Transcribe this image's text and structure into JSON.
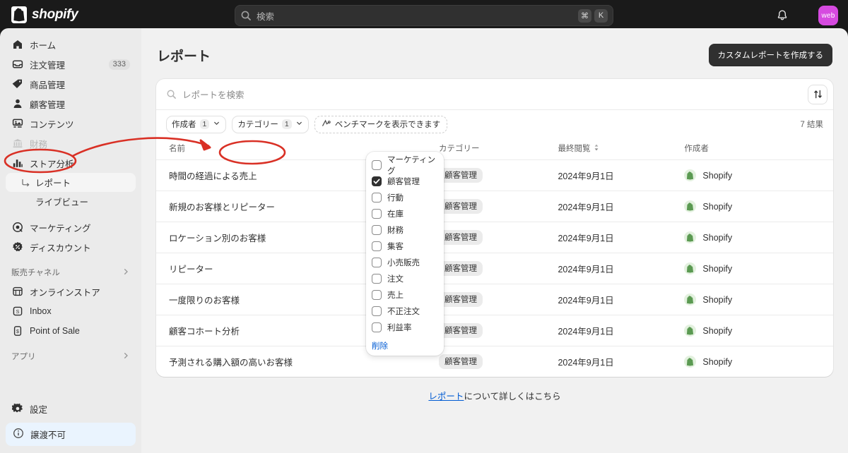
{
  "topbar": {
    "brand": "shopify",
    "search": {
      "placeholder": "検索",
      "icon": "search-icon",
      "key_cmd": "⌘",
      "key_k": "K"
    },
    "notifications_icon": "bell-icon",
    "avatar_initials": "web",
    "avatar_color": "#d64ae0"
  },
  "sidebar": {
    "items": [
      {
        "label": "ホーム",
        "icon": "home-icon",
        "badge": ""
      },
      {
        "label": "注文管理",
        "icon": "orders-icon",
        "badge": "333"
      },
      {
        "label": "商品管理",
        "icon": "tag-icon",
        "badge": ""
      },
      {
        "label": "顧客管理",
        "icon": "person-icon",
        "badge": ""
      },
      {
        "label": "コンテンツ",
        "icon": "content-icon",
        "badge": ""
      },
      {
        "label": "財務",
        "icon": "bank-icon",
        "badge": "",
        "disabled": true
      },
      {
        "label": "ストア分析",
        "icon": "chart-bar-icon",
        "badge": ""
      }
    ],
    "sub_items": [
      {
        "label": "レポート",
        "active": true
      },
      {
        "label": "ライブビュー",
        "active": false
      }
    ],
    "items_2": [
      {
        "label": "マーケティング",
        "icon": "marketing-icon"
      },
      {
        "label": "ディスカウント",
        "icon": "discount-icon"
      }
    ],
    "sales_channels": {
      "label": "販売チャネル",
      "chevron": "chevron-right-icon"
    },
    "channels": [
      {
        "label": "オンラインストア",
        "icon": "online-store-icon"
      },
      {
        "label": "Inbox",
        "icon": "inbox-icon"
      },
      {
        "label": "Point of Sale",
        "icon": "pos-icon"
      }
    ],
    "apps": {
      "label": "アプリ",
      "chevron": "chevron-right-icon"
    },
    "settings": {
      "label": "設定",
      "icon": "gear-icon"
    },
    "notice": {
      "label": "譲渡不可",
      "icon": "info-icon"
    }
  },
  "page": {
    "title": "レポート",
    "create_button": "カスタムレポートを作成する"
  },
  "card": {
    "search_placeholder": "レポートを検索",
    "search_icon": "search-icon",
    "sort_button_icon": "sort-arrows-icon",
    "filters": [
      {
        "label": "作成者",
        "count": "1",
        "chevron": "chevron-down-icon"
      },
      {
        "label": "カテゴリー",
        "count": "1",
        "chevron": "chevron-down-icon"
      }
    ],
    "benchmark_chip": {
      "label": "ベンチマークを表示できます",
      "icon": "benchmark-icon"
    },
    "result_count": "7 結果"
  },
  "table": {
    "columns": [
      "名前",
      "カテゴリー",
      "最終閲覧",
      "作成者"
    ],
    "sort_column": "最終閲覧",
    "sort_icon": "sort-caret-icon",
    "rows": [
      {
        "name": "時間の経過による売上",
        "category": "顧客管理",
        "last_viewed": "2024年9月1日",
        "author": "Shopify"
      },
      {
        "name": "新規のお客様とリピーター",
        "category": "顧客管理",
        "last_viewed": "2024年9月1日",
        "author": "Shopify"
      },
      {
        "name": "ロケーション別のお客様",
        "category": "顧客管理",
        "last_viewed": "2024年9月1日",
        "author": "Shopify"
      },
      {
        "name": "リピーター",
        "category": "顧客管理",
        "last_viewed": "2024年9月1日",
        "author": "Shopify"
      },
      {
        "name": "一度限りのお客様",
        "category": "顧客管理",
        "last_viewed": "2024年9月1日",
        "author": "Shopify"
      },
      {
        "name": "顧客コホート分析",
        "category": "顧客管理",
        "last_viewed": "2024年9月1日",
        "author": "Shopify"
      },
      {
        "name": "予測される購入額の高いお客様",
        "category": "顧客管理",
        "last_viewed": "2024年9月1日",
        "author": "Shopify"
      }
    ]
  },
  "footer": {
    "link_text": "レポート",
    "rest_text": "について詳しくはこちら"
  },
  "dropdown": {
    "options": [
      {
        "label": "マーケティング",
        "checked": false
      },
      {
        "label": "顧客管理",
        "checked": true
      },
      {
        "label": "行動",
        "checked": false
      },
      {
        "label": "在庫",
        "checked": false
      },
      {
        "label": "財務",
        "checked": false
      },
      {
        "label": "集客",
        "checked": false
      },
      {
        "label": "小売販売",
        "checked": false
      },
      {
        "label": "注文",
        "checked": false
      },
      {
        "label": "売上",
        "checked": false
      },
      {
        "label": "不正注文",
        "checked": false
      },
      {
        "label": "利益率",
        "checked": false
      }
    ],
    "clear_label": "削除"
  },
  "annotation": {
    "color": "#d93025"
  }
}
